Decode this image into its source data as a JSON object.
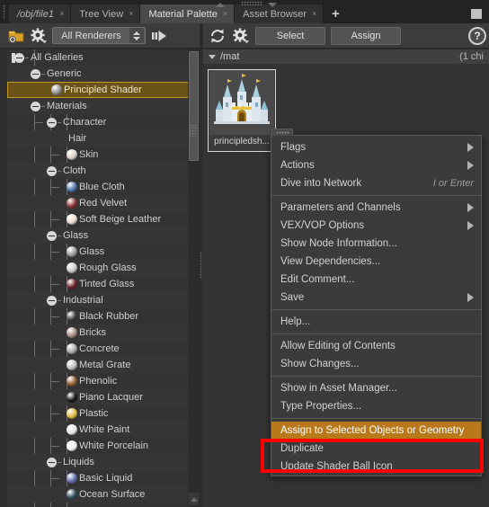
{
  "window": {
    "tabs": [
      {
        "label": "/obj/file1",
        "italic": true,
        "active": false,
        "close": "×"
      },
      {
        "label": "Tree View",
        "italic": false,
        "active": false,
        "close": "×"
      },
      {
        "label": "Material Palette",
        "italic": false,
        "active": true,
        "close": "×"
      },
      {
        "label": "Asset Browser",
        "italic": false,
        "active": false,
        "close": "×"
      }
    ],
    "add_tab_label": "+"
  },
  "left_toolbar": {
    "new_gallery_icon": "folder-add-icon",
    "gear_icon": "gear-icon",
    "renderer_filter": "All Renderers",
    "forward_icon": "step-forward-icon"
  },
  "right_toolbar": {
    "refresh_icon": "refresh-icon",
    "gear_icon": "gear-icon",
    "select_label": "Select",
    "assign_label": "Assign",
    "help_label": "?"
  },
  "tree": {
    "items": [
      {
        "label": "All Galleries",
        "depth": 0,
        "type": "root",
        "sphere": null,
        "selected": false
      },
      {
        "label": "Generic",
        "depth": 1,
        "type": "group",
        "sphere": null,
        "selected": false
      },
      {
        "label": "Principled Shader",
        "depth": 2,
        "type": "leaf",
        "sphere": "#8c8c8c",
        "selected": true
      },
      {
        "label": "Materials",
        "depth": 1,
        "type": "group",
        "sphere": null,
        "selected": false
      },
      {
        "label": "Character",
        "depth": 2,
        "type": "group",
        "sphere": null,
        "selected": false
      },
      {
        "label": "Hair",
        "depth": 3,
        "type": "leaf",
        "sphere": null,
        "selected": false
      },
      {
        "label": "Skin",
        "depth": 3,
        "type": "leaf",
        "sphere": "#d8cfc6",
        "selected": false
      },
      {
        "label": "Cloth",
        "depth": 2,
        "type": "group",
        "sphere": null,
        "selected": false
      },
      {
        "label": "Blue Cloth",
        "depth": 3,
        "type": "leaf",
        "sphere": "#4a6fa5",
        "selected": false
      },
      {
        "label": "Red Velvet",
        "depth": 3,
        "type": "leaf",
        "sphere": "#8b3030",
        "selected": false
      },
      {
        "label": "Soft Beige Leather",
        "depth": 3,
        "type": "leaf",
        "sphere": "#e8dcc8",
        "selected": false
      },
      {
        "label": "Glass",
        "depth": 2,
        "type": "group",
        "sphere": null,
        "selected": false
      },
      {
        "label": "Glass",
        "depth": 3,
        "type": "leaf",
        "sphere": "#9a9a9a",
        "selected": false
      },
      {
        "label": "Rough Glass",
        "depth": 3,
        "type": "leaf",
        "sphere": "#c9c9c9",
        "selected": false
      },
      {
        "label": "Tinted Glass",
        "depth": 3,
        "type": "leaf",
        "sphere": "#6b1f22",
        "selected": false
      },
      {
        "label": "Industrial",
        "depth": 2,
        "type": "group",
        "sphere": null,
        "selected": false
      },
      {
        "label": "Black Rubber",
        "depth": 3,
        "type": "leaf",
        "sphere": "#3a3a3a",
        "selected": false
      },
      {
        "label": "Bricks",
        "depth": 3,
        "type": "leaf",
        "sphere": "#a58a80",
        "selected": false
      },
      {
        "label": "Concrete",
        "depth": 3,
        "type": "leaf",
        "sphere": "#a8a8a8",
        "selected": false
      },
      {
        "label": "Metal Grate",
        "depth": 3,
        "type": "leaf",
        "sphere": "#bdbdbd",
        "selected": false
      },
      {
        "label": "Phenolic",
        "depth": 3,
        "type": "leaf",
        "sphere": "#8a5a2a",
        "selected": false
      },
      {
        "label": "Piano Lacquer",
        "depth": 3,
        "type": "leaf",
        "sphere": "#121212",
        "selected": false
      },
      {
        "label": "Plastic",
        "depth": 3,
        "type": "leaf",
        "sphere": "#e0b840",
        "selected": false
      },
      {
        "label": "White Paint",
        "depth": 3,
        "type": "leaf",
        "sphere": "#e6e6e6",
        "selected": false
      },
      {
        "label": "White Porcelain",
        "depth": 3,
        "type": "leaf",
        "sphere": "#f0f0f0",
        "selected": false
      },
      {
        "label": "Liquids",
        "depth": 2,
        "type": "group",
        "sphere": null,
        "selected": false
      },
      {
        "label": "Basic Liquid",
        "depth": 3,
        "type": "leaf",
        "sphere": "#5b6aa8",
        "selected": false
      },
      {
        "label": "Ocean Surface",
        "depth": 3,
        "type": "leaf",
        "sphere": "#2e4a52",
        "selected": false
      }
    ]
  },
  "mat_pane": {
    "path": "/mat",
    "child_count": "(1 chi",
    "node": {
      "caption": "principledsh...",
      "icon": "castle-icon"
    }
  },
  "context_menu": {
    "items": [
      {
        "label": "Flags",
        "submenu": true,
        "shortcut": "",
        "sep_after": false,
        "highlight": false
      },
      {
        "label": "Actions",
        "submenu": true,
        "shortcut": "",
        "sep_after": false,
        "highlight": false
      },
      {
        "label": "Dive into Network",
        "submenu": false,
        "shortcut": "I or Enter",
        "sep_after": true,
        "highlight": false
      },
      {
        "label": "Parameters and Channels",
        "submenu": true,
        "shortcut": "",
        "sep_after": false,
        "highlight": false
      },
      {
        "label": "VEX/VOP Options",
        "submenu": true,
        "shortcut": "",
        "sep_after": false,
        "highlight": false
      },
      {
        "label": "Show Node Information...",
        "submenu": false,
        "shortcut": "",
        "sep_after": false,
        "highlight": false
      },
      {
        "label": "View Dependencies...",
        "submenu": false,
        "shortcut": "",
        "sep_after": false,
        "highlight": false
      },
      {
        "label": "Edit Comment...",
        "submenu": false,
        "shortcut": "",
        "sep_after": false,
        "highlight": false
      },
      {
        "label": "Save",
        "submenu": true,
        "shortcut": "",
        "sep_after": true,
        "highlight": false
      },
      {
        "label": "Help...",
        "submenu": false,
        "shortcut": "",
        "sep_after": true,
        "highlight": false
      },
      {
        "label": "Allow Editing of Contents",
        "submenu": false,
        "shortcut": "",
        "sep_after": false,
        "highlight": false
      },
      {
        "label": "Show Changes...",
        "submenu": false,
        "shortcut": "",
        "sep_after": true,
        "highlight": false
      },
      {
        "label": "Show in Asset Manager...",
        "submenu": false,
        "shortcut": "",
        "sep_after": false,
        "highlight": false
      },
      {
        "label": "Type Properties...",
        "submenu": false,
        "shortcut": "",
        "sep_after": true,
        "highlight": false
      },
      {
        "label": "Assign to Selected Objects or Geometry",
        "submenu": false,
        "shortcut": "",
        "sep_after": false,
        "highlight": true
      },
      {
        "label": "Duplicate",
        "submenu": false,
        "shortcut": "",
        "sep_after": false,
        "highlight": false
      },
      {
        "label": "Update Shader Ball Icon",
        "submenu": false,
        "shortcut": "",
        "sep_after": false,
        "highlight": false
      }
    ]
  },
  "annotation": {
    "highlight_color": "#ff0000",
    "selected_menu_color": "#b8791a"
  }
}
